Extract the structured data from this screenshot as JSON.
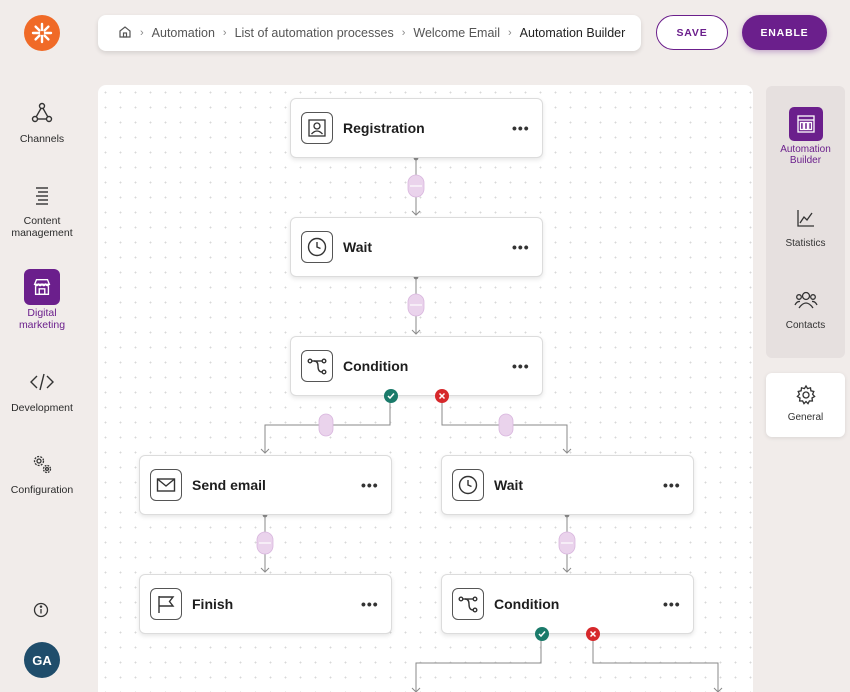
{
  "nav": {
    "items": [
      {
        "label": "Channels"
      },
      {
        "label": "Content management"
      },
      {
        "label": "Digital marketing"
      },
      {
        "label": "Development"
      },
      {
        "label": "Configuration"
      }
    ],
    "avatar_initials": "GA"
  },
  "breadcrumb": {
    "items": [
      "Automation",
      "List of automation processes",
      "Welcome Email"
    ],
    "current": "Automation Builder"
  },
  "toolbar": {
    "save_label": "SAVE",
    "enable_label": "ENABLE"
  },
  "flow": {
    "nodes": [
      {
        "label": "Registration",
        "icon": "person-badge-icon"
      },
      {
        "label": "Wait",
        "icon": "clock-icon"
      },
      {
        "label": "Condition",
        "icon": "branch-icon"
      },
      {
        "label": "Send email",
        "icon": "envelope-icon"
      },
      {
        "label": "Wait",
        "icon": "clock-icon"
      },
      {
        "label": "Finish",
        "icon": "flag-icon"
      },
      {
        "label": "Condition",
        "icon": "branch-icon"
      }
    ],
    "more_label": "•••"
  },
  "right_panel": {
    "items": [
      {
        "label": "Automation Builder"
      },
      {
        "label": "Statistics"
      },
      {
        "label": "Contacts"
      }
    ],
    "general_label": "General"
  },
  "colors": {
    "accent": "#6b1f8c",
    "logo": "#f06a27",
    "ok": "#1a7a6a",
    "error": "#d6282b"
  }
}
